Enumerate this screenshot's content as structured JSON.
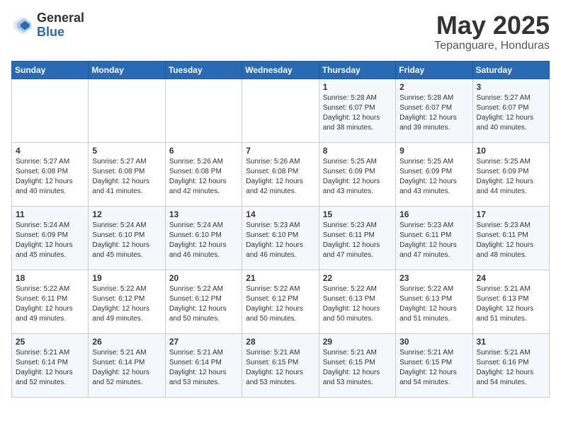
{
  "logo": {
    "general": "General",
    "blue": "Blue"
  },
  "header": {
    "title": "May 2025",
    "subtitle": "Tepanguare, Honduras"
  },
  "weekdays": [
    "Sunday",
    "Monday",
    "Tuesday",
    "Wednesday",
    "Thursday",
    "Friday",
    "Saturday"
  ],
  "weeks": [
    [
      {
        "day": "",
        "info": ""
      },
      {
        "day": "",
        "info": ""
      },
      {
        "day": "",
        "info": ""
      },
      {
        "day": "",
        "info": ""
      },
      {
        "day": "1",
        "info": "Sunrise: 5:28 AM\nSunset: 6:07 PM\nDaylight: 12 hours\nand 38 minutes."
      },
      {
        "day": "2",
        "info": "Sunrise: 5:28 AM\nSunset: 6:07 PM\nDaylight: 12 hours\nand 39 minutes."
      },
      {
        "day": "3",
        "info": "Sunrise: 5:27 AM\nSunset: 6:07 PM\nDaylight: 12 hours\nand 40 minutes."
      }
    ],
    [
      {
        "day": "4",
        "info": "Sunrise: 5:27 AM\nSunset: 6:08 PM\nDaylight: 12 hours\nand 40 minutes."
      },
      {
        "day": "5",
        "info": "Sunrise: 5:27 AM\nSunset: 6:08 PM\nDaylight: 12 hours\nand 41 minutes."
      },
      {
        "day": "6",
        "info": "Sunrise: 5:26 AM\nSunset: 6:08 PM\nDaylight: 12 hours\nand 42 minutes."
      },
      {
        "day": "7",
        "info": "Sunrise: 5:26 AM\nSunset: 6:08 PM\nDaylight: 12 hours\nand 42 minutes."
      },
      {
        "day": "8",
        "info": "Sunrise: 5:25 AM\nSunset: 6:09 PM\nDaylight: 12 hours\nand 43 minutes."
      },
      {
        "day": "9",
        "info": "Sunrise: 5:25 AM\nSunset: 6:09 PM\nDaylight: 12 hours\nand 43 minutes."
      },
      {
        "day": "10",
        "info": "Sunrise: 5:25 AM\nSunset: 6:09 PM\nDaylight: 12 hours\nand 44 minutes."
      }
    ],
    [
      {
        "day": "11",
        "info": "Sunrise: 5:24 AM\nSunset: 6:09 PM\nDaylight: 12 hours\nand 45 minutes."
      },
      {
        "day": "12",
        "info": "Sunrise: 5:24 AM\nSunset: 6:10 PM\nDaylight: 12 hours\nand 45 minutes."
      },
      {
        "day": "13",
        "info": "Sunrise: 5:24 AM\nSunset: 6:10 PM\nDaylight: 12 hours\nand 46 minutes."
      },
      {
        "day": "14",
        "info": "Sunrise: 5:23 AM\nSunset: 6:10 PM\nDaylight: 12 hours\nand 46 minutes."
      },
      {
        "day": "15",
        "info": "Sunrise: 5:23 AM\nSunset: 6:11 PM\nDaylight: 12 hours\nand 47 minutes."
      },
      {
        "day": "16",
        "info": "Sunrise: 5:23 AM\nSunset: 6:11 PM\nDaylight: 12 hours\nand 47 minutes."
      },
      {
        "day": "17",
        "info": "Sunrise: 5:23 AM\nSunset: 6:11 PM\nDaylight: 12 hours\nand 48 minutes."
      }
    ],
    [
      {
        "day": "18",
        "info": "Sunrise: 5:22 AM\nSunset: 6:11 PM\nDaylight: 12 hours\nand 49 minutes."
      },
      {
        "day": "19",
        "info": "Sunrise: 5:22 AM\nSunset: 6:12 PM\nDaylight: 12 hours\nand 49 minutes."
      },
      {
        "day": "20",
        "info": "Sunrise: 5:22 AM\nSunset: 6:12 PM\nDaylight: 12 hours\nand 50 minutes."
      },
      {
        "day": "21",
        "info": "Sunrise: 5:22 AM\nSunset: 6:12 PM\nDaylight: 12 hours\nand 50 minutes."
      },
      {
        "day": "22",
        "info": "Sunrise: 5:22 AM\nSunset: 6:13 PM\nDaylight: 12 hours\nand 50 minutes."
      },
      {
        "day": "23",
        "info": "Sunrise: 5:22 AM\nSunset: 6:13 PM\nDaylight: 12 hours\nand 51 minutes."
      },
      {
        "day": "24",
        "info": "Sunrise: 5:21 AM\nSunset: 6:13 PM\nDaylight: 12 hours\nand 51 minutes."
      }
    ],
    [
      {
        "day": "25",
        "info": "Sunrise: 5:21 AM\nSunset: 6:14 PM\nDaylight: 12 hours\nand 52 minutes."
      },
      {
        "day": "26",
        "info": "Sunrise: 5:21 AM\nSunset: 6:14 PM\nDaylight: 12 hours\nand 52 minutes."
      },
      {
        "day": "27",
        "info": "Sunrise: 5:21 AM\nSunset: 6:14 PM\nDaylight: 12 hours\nand 53 minutes."
      },
      {
        "day": "28",
        "info": "Sunrise: 5:21 AM\nSunset: 6:15 PM\nDaylight: 12 hours\nand 53 minutes."
      },
      {
        "day": "29",
        "info": "Sunrise: 5:21 AM\nSunset: 6:15 PM\nDaylight: 12 hours\nand 53 minutes."
      },
      {
        "day": "30",
        "info": "Sunrise: 5:21 AM\nSunset: 6:15 PM\nDaylight: 12 hours\nand 54 minutes."
      },
      {
        "day": "31",
        "info": "Sunrise: 5:21 AM\nSunset: 6:16 PM\nDaylight: 12 hours\nand 54 minutes."
      }
    ]
  ]
}
